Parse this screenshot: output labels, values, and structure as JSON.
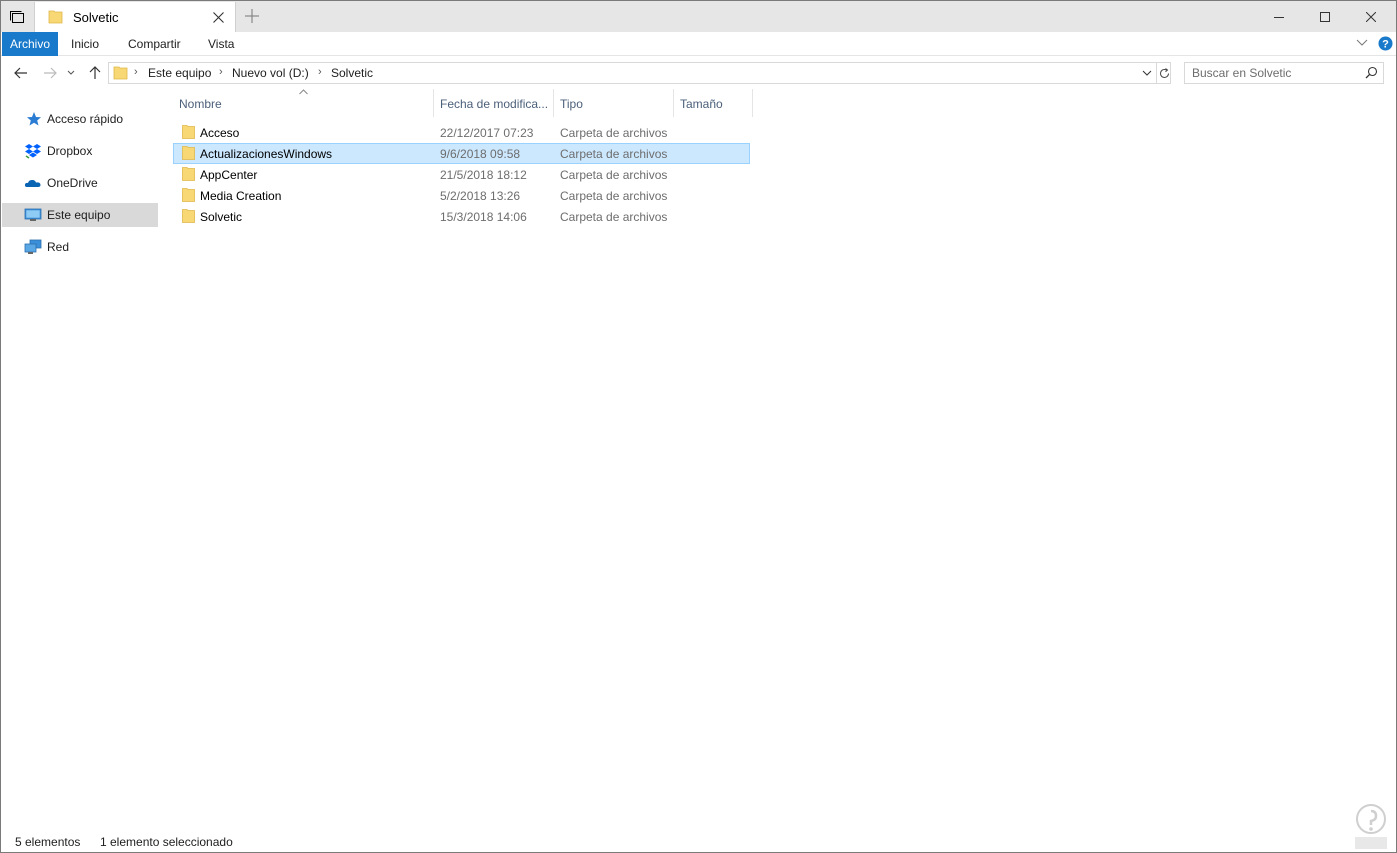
{
  "tab": {
    "title": "Solvetic"
  },
  "ribbon": {
    "tabs": [
      "Archivo",
      "Inicio",
      "Compartir",
      "Vista"
    ]
  },
  "address": {
    "crumbs": [
      "Este equipo",
      "Nuevo vol (D:)",
      "Solvetic"
    ]
  },
  "search": {
    "placeholder": "Buscar en Solvetic"
  },
  "navpane": {
    "items": [
      {
        "label": "Acceso rápido",
        "icon": "star-icon"
      },
      {
        "label": "Dropbox",
        "icon": "dropbox-icon"
      },
      {
        "label": "OneDrive",
        "icon": "onedrive-icon"
      },
      {
        "label": "Este equipo",
        "icon": "computer-icon",
        "selected": true
      },
      {
        "label": "Red",
        "icon": "network-icon"
      }
    ]
  },
  "columns": [
    "Nombre",
    "Fecha de modifica...",
    "Tipo",
    "Tamaño"
  ],
  "files": [
    {
      "name": "Acceso",
      "date": "22/12/2017 07:23",
      "type": "Carpeta de archivos"
    },
    {
      "name": "ActualizacionesWindows",
      "date": "9/6/2018 09:58",
      "type": "Carpeta de archivos",
      "selected": true
    },
    {
      "name": "AppCenter",
      "date": "21/5/2018 18:12",
      "type": "Carpeta de archivos"
    },
    {
      "name": "Media Creation",
      "date": "5/2/2018 13:26",
      "type": "Carpeta de archivos"
    },
    {
      "name": "Solvetic",
      "date": "15/3/2018 14:06",
      "type": "Carpeta de archivos"
    }
  ],
  "status": {
    "count": "5 elementos",
    "selection": "1 elemento seleccionado"
  },
  "colors": {
    "accent": "#1979ca",
    "selection": "#cce8ff",
    "folder": "#f8d775"
  }
}
